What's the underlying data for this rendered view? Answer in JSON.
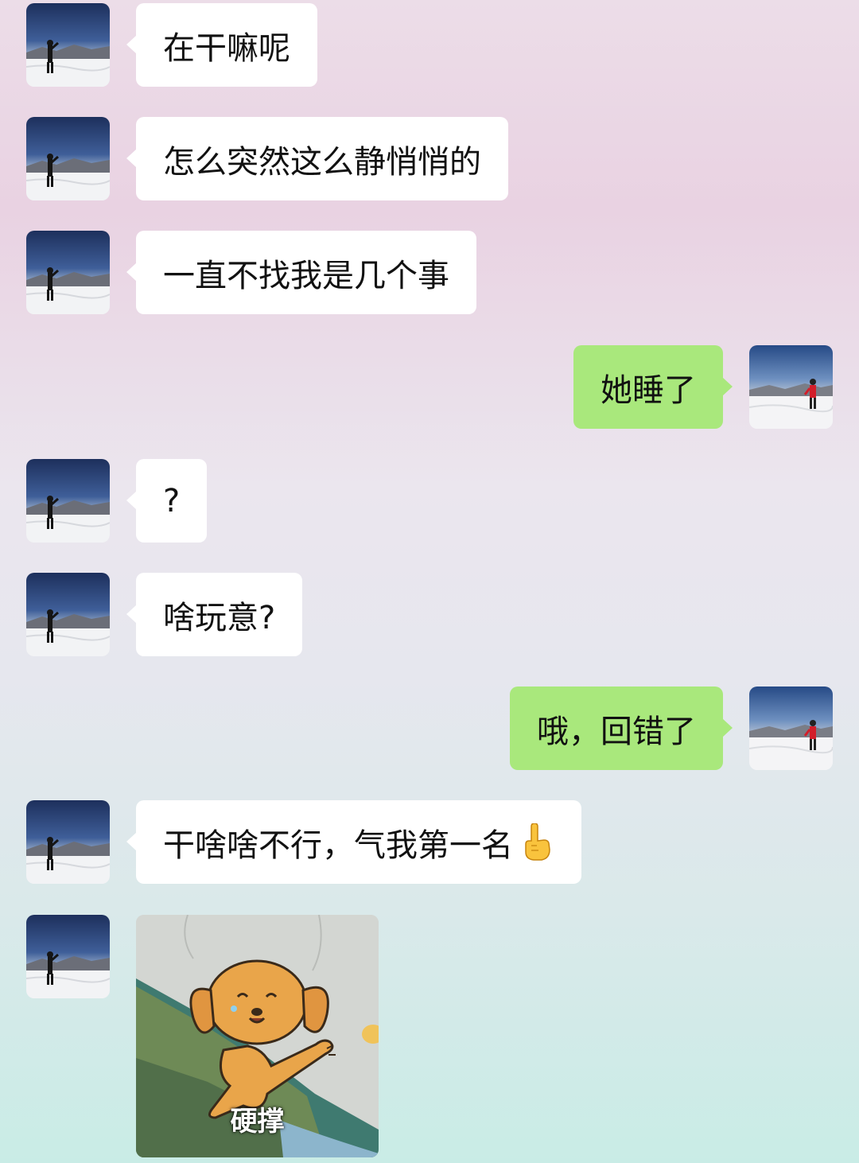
{
  "messages": [
    {
      "side": "in",
      "text": "在干嘛呢"
    },
    {
      "side": "in",
      "text": "怎么突然这么静悄悄的"
    },
    {
      "side": "in",
      "text": "一直不找我是几个事"
    },
    {
      "side": "out",
      "text": "她睡了"
    },
    {
      "side": "in",
      "text": "?"
    },
    {
      "side": "in",
      "text": "啥玩意?"
    },
    {
      "side": "out",
      "text": "哦，回错了"
    },
    {
      "side": "in",
      "text": "干啥啥不行，气我第一名",
      "emoji": "index-finger-up-icon"
    },
    {
      "side": "in",
      "type": "sticker",
      "caption": "硬撑",
      "sticker": "waving-dog-sticker"
    }
  ],
  "colors": {
    "incoming_bubble": "#ffffff",
    "outgoing_bubble": "#a9e87c",
    "text": "#111111"
  }
}
